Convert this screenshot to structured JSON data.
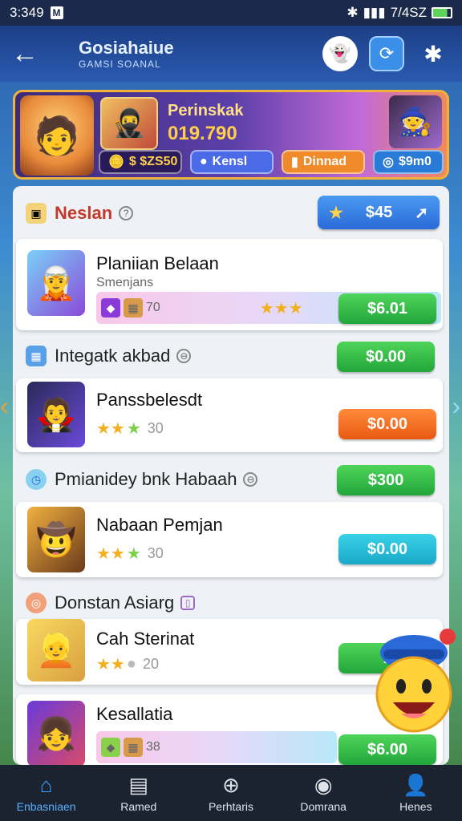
{
  "status_bar": {
    "time": "3:349",
    "right_text": "7/4SZ",
    "icons": [
      "mail-icon",
      "bluetooth-icon",
      "signal-icon",
      "battery-icon"
    ]
  },
  "header": {
    "title": "Gosiahaiue",
    "subtitle": "GAMSI SOANAL",
    "icons": [
      "back-arrow-icon",
      "ghost-icon",
      "sync-icon",
      "settings-icon"
    ]
  },
  "hero": {
    "name": "Perinskak",
    "score": "019.790",
    "chips": [
      "$ $ZS50",
      "Kensl",
      "Dinnad",
      "$9m0"
    ]
  },
  "sections": [
    {
      "title": "Neslan",
      "button": "$45",
      "card": {
        "title": "Planiian Belaan",
        "subtitle": "Smenjans",
        "strip_number": "70",
        "price": "$6.01"
      }
    },
    {
      "title": "Integatk akbad",
      "price": "$0.00",
      "card": {
        "title": "Panssbelesdt",
        "rating": "30",
        "price": "$0.00"
      }
    },
    {
      "title": "Pmianidey bnk Habaah",
      "price": "$300",
      "card": {
        "title": "Nabaan Pemjan",
        "rating": "30",
        "price": "$0.00"
      }
    },
    {
      "title": "Donstan Asiarg",
      "card": {
        "title": "Cah Sterinat",
        "rating": "20",
        "price": "1"
      }
    },
    {
      "card": {
        "title": "Kesallatia",
        "strip_number": "38",
        "price": "$6.00"
      }
    }
  ],
  "bottom_nav": [
    {
      "label": "Enbasniaen",
      "icon": "home-icon"
    },
    {
      "label": "Ramed",
      "icon": "cards-icon"
    },
    {
      "label": "Perhtaris",
      "icon": "plus-circle-icon"
    },
    {
      "label": "Domrana",
      "icon": "compass-icon"
    },
    {
      "label": "Henes",
      "icon": "profile-icon"
    }
  ],
  "colors": {
    "header": "#1d3f86",
    "accent_green": "#22a63a",
    "accent_orange": "#e85a12",
    "accent_cyan": "#1aa8c8",
    "nav_active": "#3ba0ff"
  }
}
